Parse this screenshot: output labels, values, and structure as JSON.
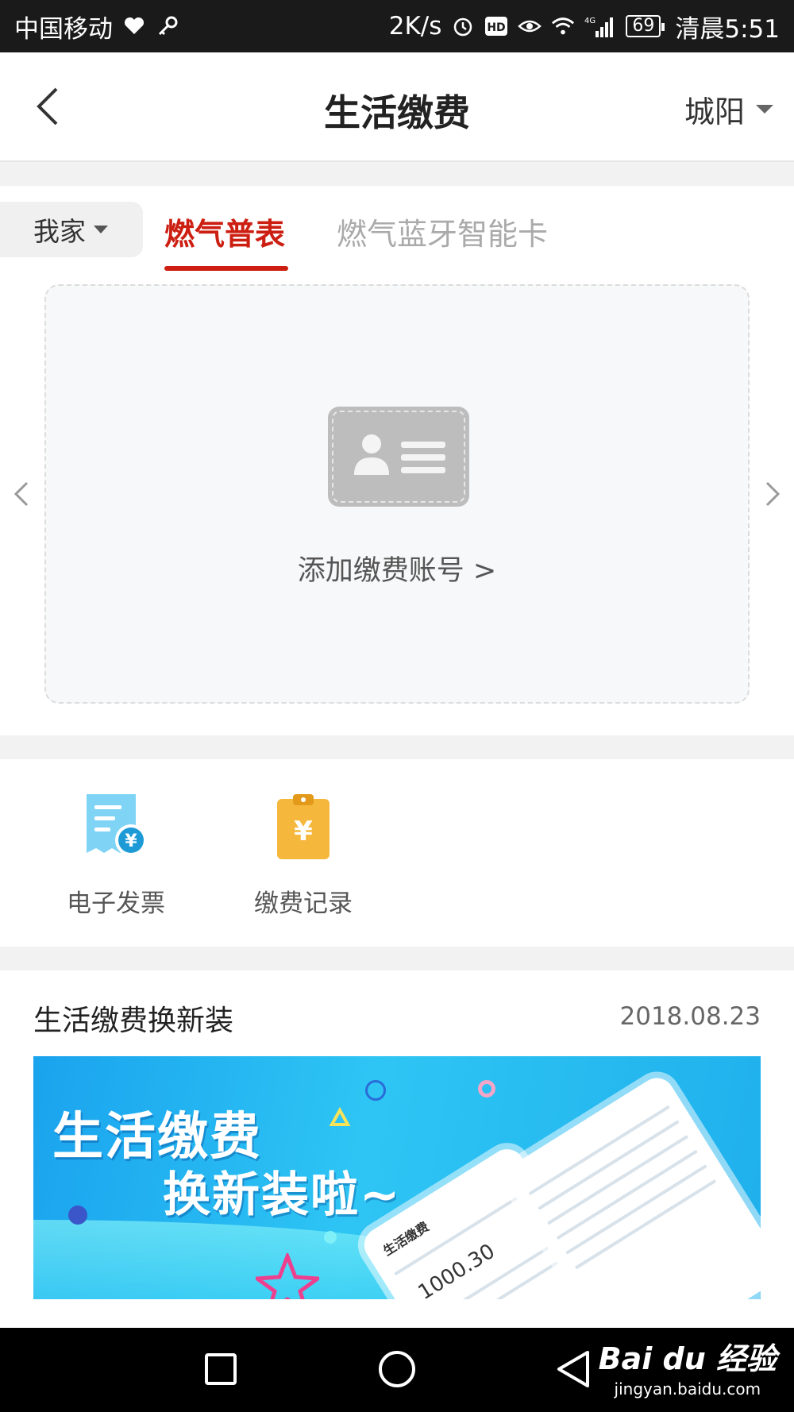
{
  "status_bar": {
    "carrier": "中国移动",
    "speed": "2K/s",
    "network": "4G",
    "battery": "69",
    "time": "清晨5:51"
  },
  "header": {
    "title": "生活缴费",
    "city": "城阳"
  },
  "tabs": {
    "home_select": "我家",
    "items": [
      {
        "label": "燃气普表",
        "active": true
      },
      {
        "label": "燃气蓝牙智能卡",
        "active": false
      }
    ]
  },
  "account": {
    "add_label": "添加缴费账号 >"
  },
  "services": [
    {
      "label": "电子发票",
      "icon": "invoice-icon",
      "color": "#5bc8f2"
    },
    {
      "label": "缴费记录",
      "icon": "clipboard-yuan-icon",
      "color": "#f5b83d"
    }
  ],
  "news": {
    "title": "生活缴费换新装",
    "date": "2018.08.23",
    "banner_line1": "生活缴费",
    "banner_line2": "换新装啦~",
    "mock_amount": "1000.30",
    "mock_title": "生活缴费"
  },
  "watermark": {
    "logo": "Bai du 经验",
    "url": "jingyan.baidu.com"
  },
  "colors": {
    "accent": "#cc1f12",
    "status_bar_bg": "#1a1a1a",
    "nav_bar_bg": "#000000"
  }
}
